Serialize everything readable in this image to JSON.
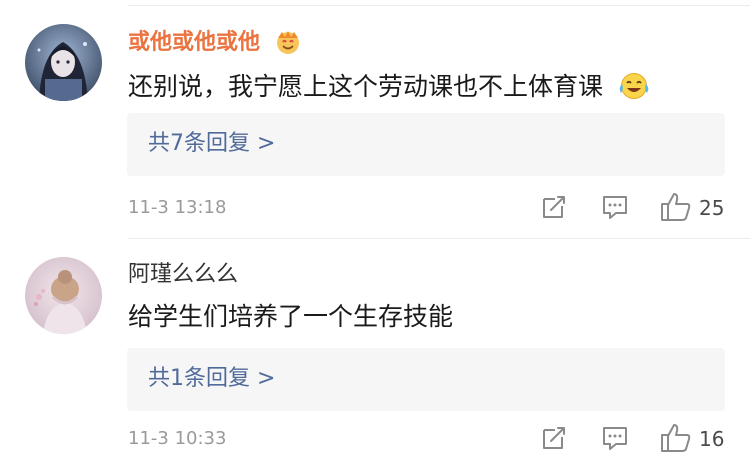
{
  "comments": [
    {
      "username": "或他或他或他",
      "badge_icon": "vip-badge-icon",
      "content": "还别说，我宁愿上这个劳动课也不上体育课",
      "content_emoji": "laugh-cry-emoji-icon",
      "replies_label": "共7条回复 >",
      "timestamp": "11-3 13:18",
      "like_count": "25"
    },
    {
      "username": "阿瑾么么么",
      "content": "给学生们培养了一个生存技能",
      "replies_label": "共1条回复 >",
      "timestamp": "11-3 10:33",
      "like_count": "16"
    }
  ],
  "colors": {
    "vip_username": "#eb7340",
    "username": "#333333",
    "link": "#506b9a",
    "meta": "#9a9a9a",
    "reply_box_bg": "#f6f6f6"
  }
}
